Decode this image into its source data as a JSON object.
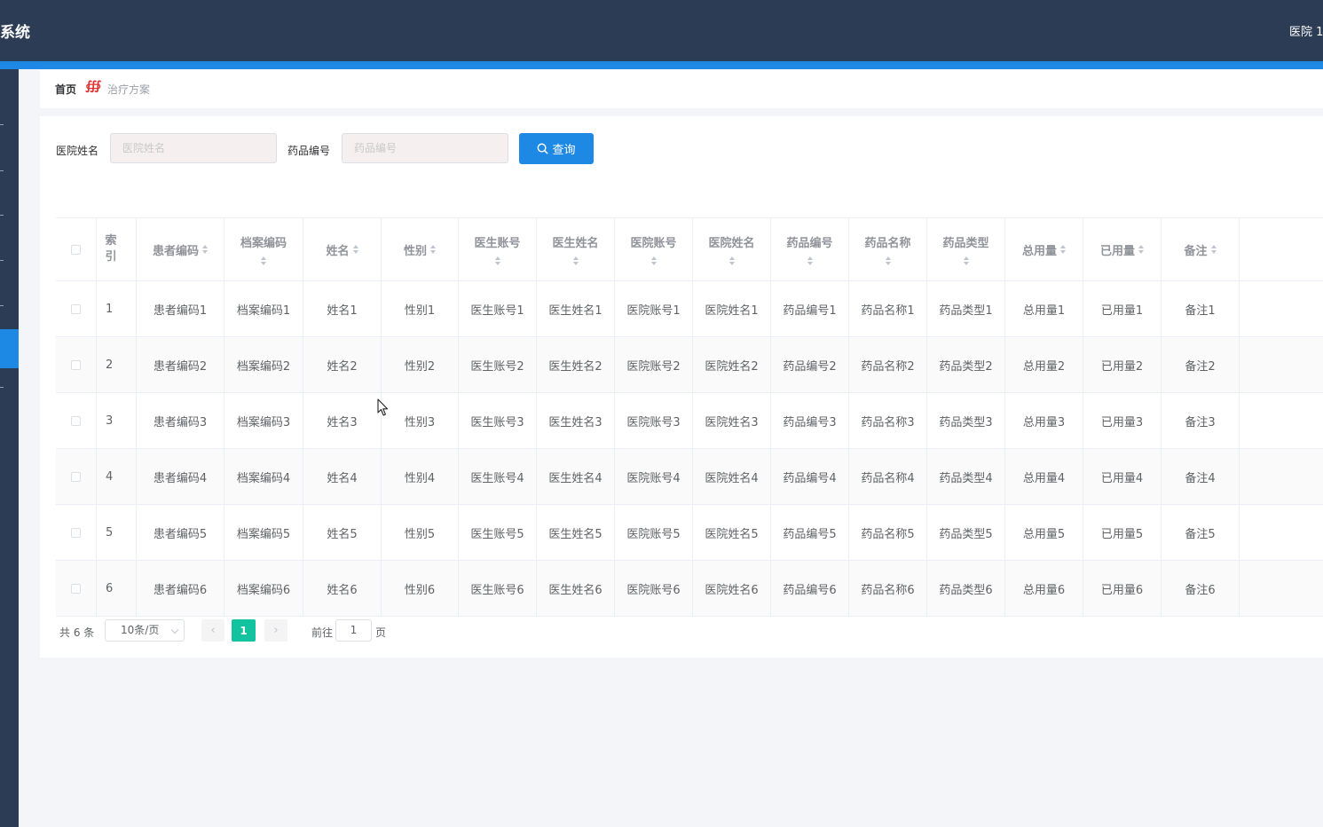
{
  "header": {
    "title": "系统",
    "user": "医院 1"
  },
  "breadcrumb": {
    "home": "首页",
    "separator": "∰",
    "current": "治疗方案"
  },
  "search": {
    "hospital_label": "医院姓名",
    "hospital_placeholder": "医院姓名",
    "drug_label": "药品编号",
    "drug_placeholder": "药品编号",
    "query_button": "查询"
  },
  "table": {
    "columns": [
      {
        "key": "index",
        "label": "索引",
        "sortable": false
      },
      {
        "key": "patient_code",
        "label": "患者编码",
        "sortable": true
      },
      {
        "key": "archive_code",
        "label": "档案编码",
        "sortable": true
      },
      {
        "key": "name",
        "label": "姓名",
        "sortable": true
      },
      {
        "key": "gender",
        "label": "性别",
        "sortable": true
      },
      {
        "key": "doctor_account",
        "label": "医生账号",
        "sortable": true
      },
      {
        "key": "doctor_name",
        "label": "医生姓名",
        "sortable": true
      },
      {
        "key": "hospital_account",
        "label": "医院账号",
        "sortable": true
      },
      {
        "key": "hospital_name",
        "label": "医院姓名",
        "sortable": true
      },
      {
        "key": "drug_code",
        "label": "药品编号",
        "sortable": true
      },
      {
        "key": "drug_name",
        "label": "药品名称",
        "sortable": true
      },
      {
        "key": "drug_type",
        "label": "药品类型",
        "sortable": true
      },
      {
        "key": "total",
        "label": "总用量",
        "sortable": true
      },
      {
        "key": "used",
        "label": "已用量",
        "sortable": true
      },
      {
        "key": "remark",
        "label": "备注",
        "sortable": true
      }
    ],
    "rows": [
      [
        "1",
        "患者编码1",
        "档案编码1",
        "姓名1",
        "性别1",
        "医生账号1",
        "医生姓名1",
        "医院账号1",
        "医院姓名1",
        "药品编号1",
        "药品名称1",
        "药品类型1",
        "总用量1",
        "已用量1",
        "备注1"
      ],
      [
        "2",
        "患者编码2",
        "档案编码2",
        "姓名2",
        "性别2",
        "医生账号2",
        "医生姓名2",
        "医院账号2",
        "医院姓名2",
        "药品编号2",
        "药品名称2",
        "药品类型2",
        "总用量2",
        "已用量2",
        "备注2"
      ],
      [
        "3",
        "患者编码3",
        "档案编码3",
        "姓名3",
        "性别3",
        "医生账号3",
        "医生姓名3",
        "医院账号3",
        "医院姓名3",
        "药品编号3",
        "药品名称3",
        "药品类型3",
        "总用量3",
        "已用量3",
        "备注3"
      ],
      [
        "4",
        "患者编码4",
        "档案编码4",
        "姓名4",
        "性别4",
        "医生账号4",
        "医生姓名4",
        "医院账号4",
        "医院姓名4",
        "药品编号4",
        "药品名称4",
        "药品类型4",
        "总用量4",
        "已用量4",
        "备注4"
      ],
      [
        "5",
        "患者编码5",
        "档案编码5",
        "姓名5",
        "性别5",
        "医生账号5",
        "医生姓名5",
        "医院账号5",
        "医院姓名5",
        "药品编号5",
        "药品名称5",
        "药品类型5",
        "总用量5",
        "已用量5",
        "备注5"
      ],
      [
        "6",
        "患者编码6",
        "档案编码6",
        "姓名6",
        "性别6",
        "医生账号6",
        "医生姓名6",
        "医院账号6",
        "医院姓名6",
        "药品编号6",
        "药品名称6",
        "药品类型6",
        "总用量6",
        "已用量6",
        "备注6"
      ]
    ]
  },
  "pagination": {
    "total": "共 6 条",
    "page_size": "10条/页",
    "prev": "‹",
    "current_page": "1",
    "next": "›",
    "goto_label": "前往",
    "goto_value": "1",
    "page_unit": "页"
  },
  "colors": {
    "header": "#2c3c55",
    "accent": "#1e88e5",
    "active_page": "#13c29f"
  }
}
